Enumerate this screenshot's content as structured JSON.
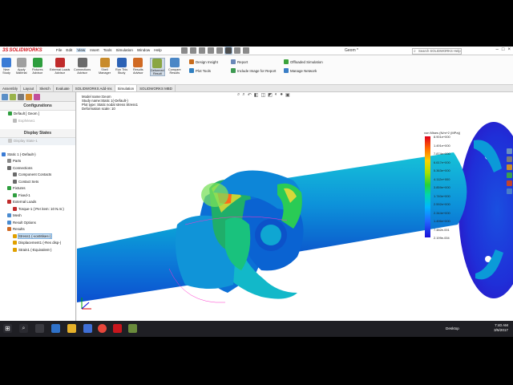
{
  "app": {
    "brand": "SOLIDWORKS",
    "menus": [
      "File",
      "Edit",
      "View",
      "Insert",
      "Tools",
      "Simulation",
      "Window",
      "Help"
    ],
    "active_menu": "View",
    "doc_title": "Geom *",
    "search_placeholder": "Search SOLIDWORKS Help"
  },
  "ribbon": {
    "buttons": [
      {
        "label": "New\nStudy",
        "icon": "new-study-icon",
        "color": "#3a7bd5"
      },
      {
        "label": "Apply\nMaterial",
        "icon": "apply-material-icon",
        "color": "#a0a0a0"
      },
      {
        "label": "Fixtures\nAdvisor",
        "icon": "fixtures-icon",
        "color": "#2e9e3e"
      },
      {
        "label": "External Loads\nAdvisor",
        "icon": "external-loads-icon",
        "color": "#c02b2b"
      },
      {
        "label": "Connections\nAdvisor",
        "icon": "connections-icon",
        "color": "#6a6a6a"
      },
      {
        "label": "Shell\nManager",
        "icon": "shell-manager-icon",
        "color": "#c88b2b"
      },
      {
        "label": "Run This\nStudy",
        "icon": "run-study-icon",
        "color": "#2c62b5"
      },
      {
        "label": "Results\nAdvisor",
        "icon": "results-advisor-icon",
        "color": "#d06a23"
      },
      {
        "label": "Deformed\nResult",
        "icon": "deformed-result-icon",
        "color": "#8aa642"
      },
      {
        "label": "Compare\nResults",
        "icon": "compare-results-icon",
        "color": "#4b87c6"
      }
    ],
    "small": [
      {
        "label": "Design Insight",
        "icon": "design-insight-icon",
        "color": "#c76b1b"
      },
      {
        "label": "Plot Tools",
        "icon": "plot-tools-icon",
        "color": "#2f7fc0"
      },
      {
        "label": "Report",
        "icon": "report-icon",
        "color": "#6a88b8"
      },
      {
        "label": "Include Image for Report",
        "icon": "include-image-icon",
        "color": "#3e9a52"
      },
      {
        "label": "Offloaded Simulation",
        "icon": "offloaded-simulation-icon",
        "color": "#3ba33b"
      },
      {
        "label": "Manage Network",
        "icon": "manage-network-icon",
        "color": "#3a7ec6"
      }
    ]
  },
  "cm_tabs": [
    "Assembly",
    "Layout",
    "Sketch",
    "Evaluate",
    "SOLIDWORKS Add-Ins",
    "Simulation",
    "SOLIDWORKS MBD"
  ],
  "active_cm_tab": "Simulation",
  "configurations": {
    "section": "Configurations",
    "default": "Default [ Geom ]",
    "explode": "ExplView1",
    "display_states": "Display States",
    "display_state_1": "Display State-1"
  },
  "study_tree": [
    {
      "label": "Static 1 (-Default-)",
      "indent": 0,
      "icon": "study-icon",
      "color": "#3a7bd5"
    },
    {
      "label": "Parts",
      "indent": 1,
      "icon": "parts-icon",
      "color": "#8a8a8a"
    },
    {
      "label": "Connections",
      "indent": 1,
      "icon": "connections-icon",
      "color": "#6a6a6a"
    },
    {
      "label": "Component Contacts",
      "indent": 2,
      "icon": "component-contacts-icon",
      "color": "#6a6a6a"
    },
    {
      "label": "Contact Sets",
      "indent": 2,
      "icon": "contact-sets-icon",
      "color": "#6a6a6a"
    },
    {
      "label": "Fixtures",
      "indent": 1,
      "icon": "fixtures-icon",
      "color": "#2e9e3e"
    },
    {
      "label": "Fixed-1",
      "indent": 2,
      "icon": "fixed-icon",
      "color": "#2e9e3e"
    },
    {
      "label": "External Loads",
      "indent": 1,
      "icon": "external-loads-icon",
      "color": "#c02b2b"
    },
    {
      "label": "Torque-1 (:Per item: 10 N.m:)",
      "indent": 2,
      "icon": "torque-icon",
      "color": "#c02b2b"
    },
    {
      "label": "Mesh",
      "indent": 1,
      "icon": "mesh-icon",
      "color": "#4a8bd0"
    },
    {
      "label": "Result Options",
      "indent": 1,
      "icon": "result-options-icon",
      "color": "#4a8bd0"
    },
    {
      "label": "Results",
      "indent": 1,
      "icon": "results-icon",
      "color": "#d06a23"
    },
    {
      "label": "Stress1 (-vonMises-)",
      "indent": 2,
      "icon": "stress-plot-icon",
      "color": "#e0a000",
      "selected": true
    },
    {
      "label": "Displacement1 (-Res disp-)",
      "indent": 2,
      "icon": "displacement-plot-icon",
      "color": "#e0a000"
    },
    {
      "label": "Strain1 (-Equivalent-)",
      "indent": 2,
      "icon": "strain-plot-icon",
      "color": "#e0a000"
    }
  ],
  "model_info": [
    "Model name:Geom",
    "Study name:Static 1(-Default-)",
    "Plot type: Static nodal stress Stress1",
    "Deformation scale: 10"
  ],
  "legend": {
    "title": "von Mises (N/m^2 (MPa))",
    "values": [
      "8.901e+000",
      "1.491e+000",
      "7.874e+000",
      "6.617e+000",
      "5.363e+000",
      "4.112e+000",
      "3.859e+000",
      "1.740e+000",
      "2.592e+000",
      "2.344e+000",
      "1.496e+000",
      "7.482e-001",
      "2.199e-004"
    ],
    "value_tops": [
      0,
      10.5,
      21,
      31.5,
      42,
      52.5,
      63,
      73.5,
      84,
      94.5,
      105,
      115.5,
      126
    ]
  },
  "bottom_tabs": [
    "Model",
    "3D Views",
    "Motion Study 1",
    "Static 1"
  ],
  "active_bottom_tab": "Static 1",
  "status": {
    "edition": "SOLIDWORKS Premium 2017 x64 Edition",
    "defined": "Fully Defined",
    "editing": "Editing Assembly",
    "units": "MMGS"
  },
  "taskbar": {
    "desktop": "Desktop",
    "time": "7:40 AM",
    "date": "3/5/2017"
  }
}
